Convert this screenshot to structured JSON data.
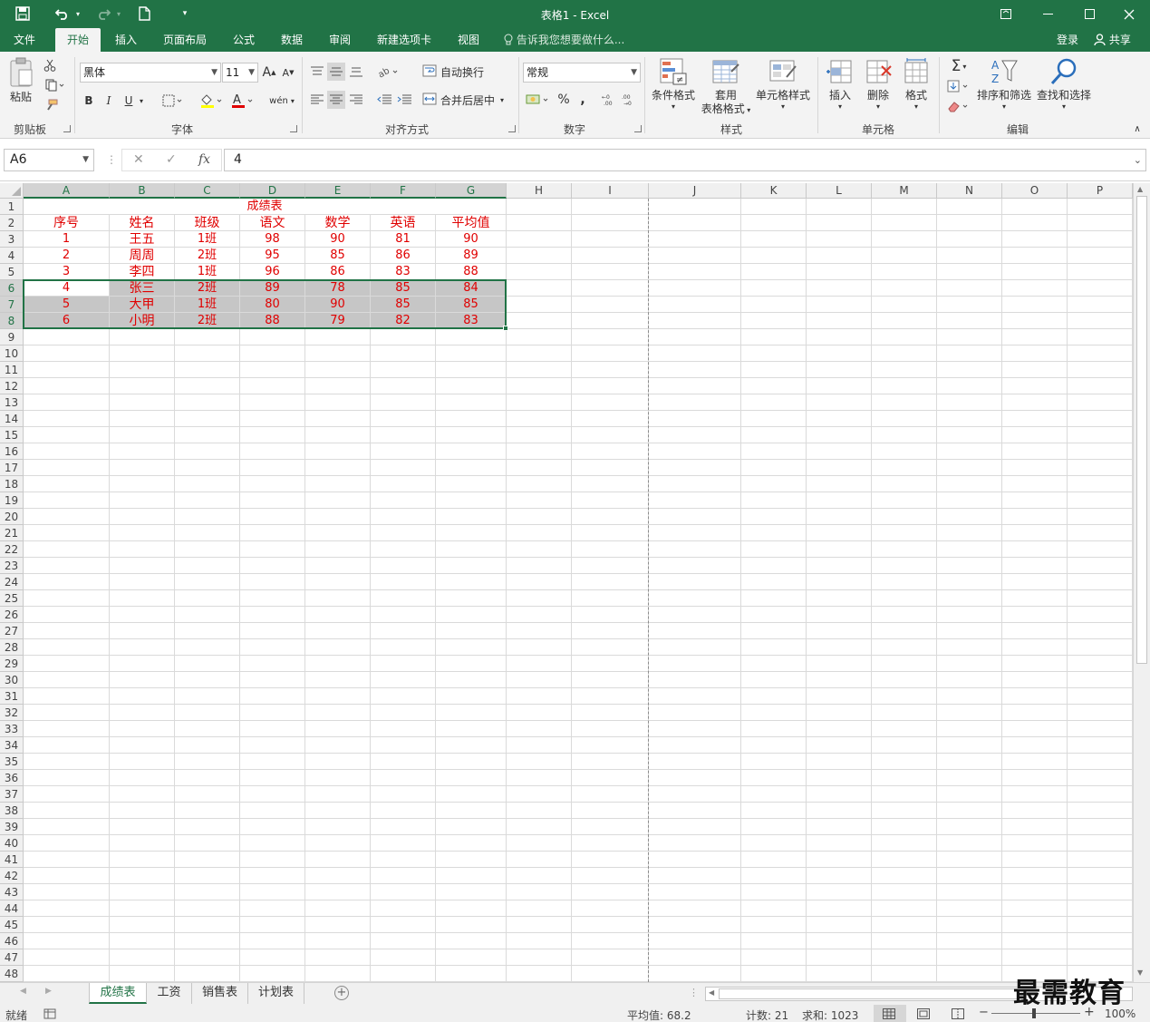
{
  "window": {
    "title": "表格1 - Excel"
  },
  "menu": {
    "tabs": [
      {
        "label": "文件"
      },
      {
        "label": "开始"
      },
      {
        "label": "插入"
      },
      {
        "label": "页面布局"
      },
      {
        "label": "公式"
      },
      {
        "label": "数据"
      },
      {
        "label": "审阅"
      },
      {
        "label": "新建选项卡"
      },
      {
        "label": "视图"
      }
    ],
    "active_tab": "开始",
    "tell_me": "告诉我您想要做什么...",
    "login": "登录",
    "share": "共享"
  },
  "ribbon": {
    "groups": {
      "clipboard": "剪贴板",
      "font": "字体",
      "alignment": "对齐方式",
      "number": "数字",
      "styles": "样式",
      "cells": "单元格",
      "editing": "编辑"
    },
    "paste_label": "粘贴",
    "font_name": "黑体",
    "font_size": "11",
    "bold": "B",
    "italic": "I",
    "underline": "U",
    "wrap_text": "自动换行",
    "merge_center": "合并后居中",
    "number_format": "常规",
    "percent": "%",
    "comma": ",",
    "conditional_format": "条件格式",
    "table_format_1": "套用",
    "table_format_2": "表格格式",
    "cell_styles": "单元格样式",
    "insert": "插入",
    "delete": "删除",
    "format": "格式",
    "sort_filter": "排序和筛选",
    "find_select": "查找和选择",
    "sigma": "Σ",
    "wen": "wén"
  },
  "formula_bar": {
    "name_box": "A6",
    "fx": "fx",
    "value": "4"
  },
  "sheet": {
    "columns": [
      "A",
      "B",
      "C",
      "D",
      "E",
      "F",
      "G",
      "H",
      "I",
      "J",
      "K",
      "L",
      "M",
      "N",
      "O",
      "P"
    ],
    "title_cell": "成绩表",
    "headers": [
      "序号",
      "姓名",
      "班级",
      "语文",
      "数学",
      "英语",
      "平均值"
    ],
    "rows": [
      [
        "1",
        "王五",
        "1班",
        "98",
        "90",
        "81",
        "90"
      ],
      [
        "2",
        "周周",
        "2班",
        "95",
        "85",
        "86",
        "89"
      ],
      [
        "3",
        "李四",
        "1班",
        "96",
        "86",
        "83",
        "88"
      ],
      [
        "4",
        "张三",
        "2班",
        "89",
        "78",
        "85",
        "84"
      ],
      [
        "5",
        "大甲",
        "1班",
        "80",
        "90",
        "85",
        "85"
      ],
      [
        "6",
        "小明",
        "2班",
        "88",
        "79",
        "82",
        "83"
      ]
    ],
    "row_count": 48
  },
  "sheet_tabs": [
    {
      "label": "成绩表"
    },
    {
      "label": "工资"
    },
    {
      "label": "销售表"
    },
    {
      "label": "计划表"
    }
  ],
  "status": {
    "ready": "就绪",
    "average": "平均值: 68.2",
    "count": "计数: 21",
    "sum": "求和: 1023",
    "zoom": "100%"
  },
  "watermark": "最需教育",
  "colors": {
    "accent": "#217346",
    "cell_text": "#e00000",
    "selection_fill": "#c6c6c6"
  }
}
